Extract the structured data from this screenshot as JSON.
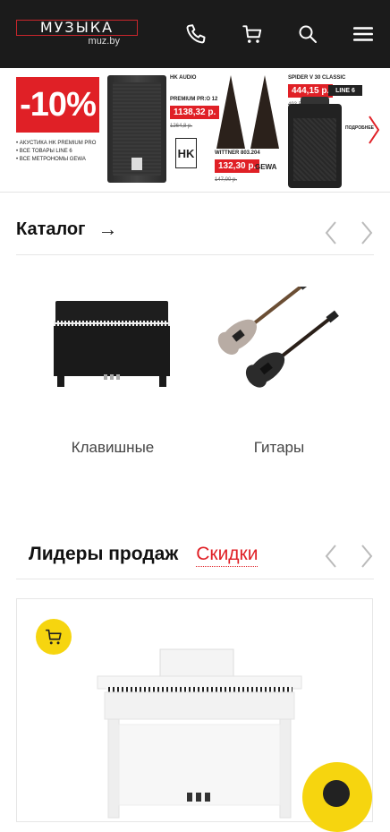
{
  "header": {
    "logo_word": "МУЗЫКА",
    "logo_sub": "muz.by",
    "phone_icon": "phone-icon",
    "cart_icon": "cart-icon",
    "search_icon": "search-icon",
    "menu_icon": "menu-icon"
  },
  "banner": {
    "discount": "-10%",
    "bullets": [
      "• Акустика HK Premium Pro",
      "• Все товары Line 6",
      "• Все метрономы Gewa"
    ],
    "p1_brand": "HK Audio",
    "p1_name": "Premium PR:O 12",
    "p1_price": "1138,32 р.",
    "p1_old": "1264,8 р.",
    "p1_logo": "HK",
    "p2_name": "Wittner 803.204",
    "p2_price": "132,30 р.",
    "p2_old": "147,00 р.",
    "p2_brand": "GEWA",
    "p3_name": "Spider V 30 Classic",
    "p3_price": "444,15 р.",
    "p3_old": "493,50",
    "p3_brand": "LINE 6",
    "more": "Подробнее"
  },
  "catalog": {
    "title": "Каталог",
    "arrow": "→",
    "items": [
      {
        "label": "Клавишные"
      },
      {
        "label": "Гитары"
      }
    ]
  },
  "sales": {
    "leaders": "Лидеры продаж",
    "discounts": "Скидки"
  },
  "colors": {
    "header_bg": "#1b1b1b",
    "accent_red": "#e02026",
    "accent_yellow": "#f6d50f"
  }
}
